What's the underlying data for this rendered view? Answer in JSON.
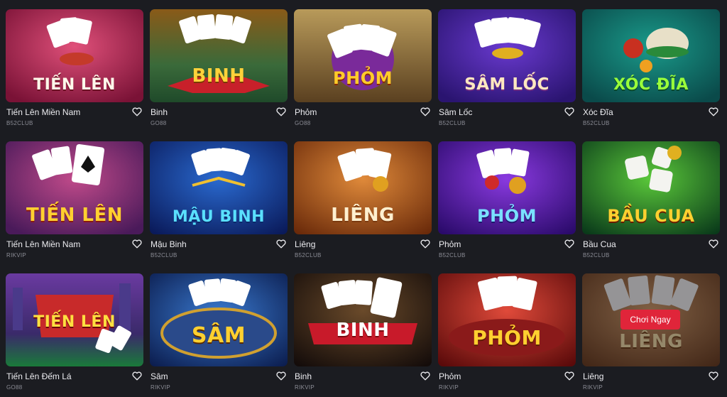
{
  "games": [
    {
      "name": "Tiến Lên Miền Nam",
      "provider": "B52CLUB",
      "art": "TIẾN LÊN"
    },
    {
      "name": "Binh",
      "provider": "GO88",
      "art": "BINH"
    },
    {
      "name": "Phỏm",
      "provider": "GO88",
      "art": "PHỎM"
    },
    {
      "name": "Sâm Lốc",
      "provider": "B52CLUB",
      "art": "SÂM LỐC"
    },
    {
      "name": "Xóc Đĩa",
      "provider": "B52CLUB",
      "art": "XÓC ĐĨA"
    },
    {
      "name": "Tiến Lên Miền Nam",
      "provider": "RIKVIP",
      "art": "TIẾN LÊN"
    },
    {
      "name": "Mậu Binh",
      "provider": "B52CLUB",
      "art": "MẬU BINH"
    },
    {
      "name": "Liêng",
      "provider": "B52CLUB",
      "art": "LIÊNG"
    },
    {
      "name": "Phỏm",
      "provider": "B52CLUB",
      "art": "PHỎM"
    },
    {
      "name": "Bầu Cua",
      "provider": "B52CLUB",
      "art": "BẦU CUA"
    },
    {
      "name": "Tiến Lên Đếm Lá",
      "provider": "GO88",
      "art": "TIẾN LÊN"
    },
    {
      "name": "Sâm",
      "provider": "RIKVIP",
      "art": "SÂM"
    },
    {
      "name": "Binh",
      "provider": "RIKVIP",
      "art": "BINH"
    },
    {
      "name": "Phỏm",
      "provider": "RIKVIP",
      "art": "PHỎM"
    },
    {
      "name": "Liêng",
      "provider": "RIKVIP",
      "art": "LIÊNG"
    }
  ],
  "hover_card": {
    "play_label": "Chơi Ngay"
  },
  "icons": {
    "favorite": "heart-outline-icon"
  },
  "colors": {
    "background": "#1b1c21",
    "play_button": "#e0253a",
    "provider_text": "#8c8d96"
  }
}
